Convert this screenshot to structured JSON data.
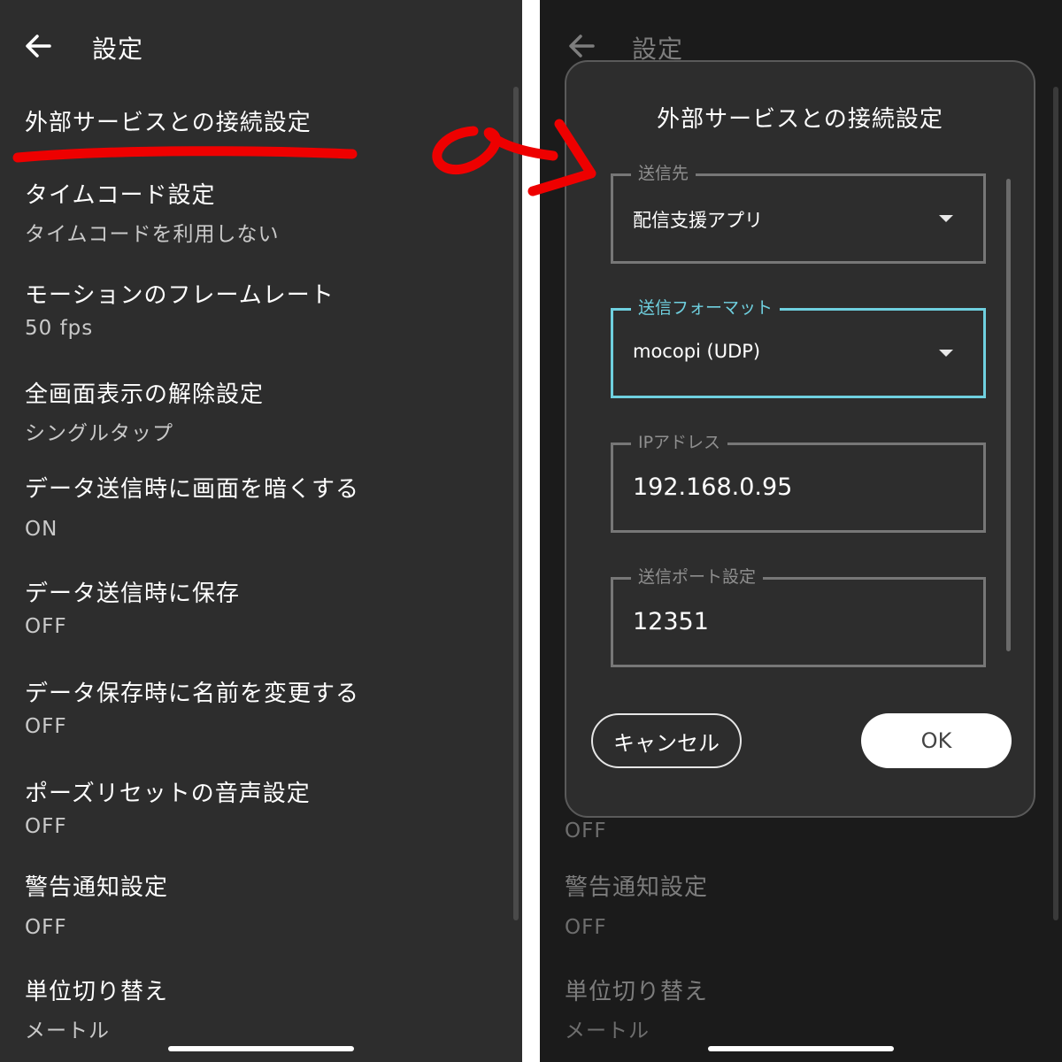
{
  "left": {
    "title": "設定",
    "items": [
      {
        "title": "外部サービスとの接続設定"
      },
      {
        "title": "タイムコード設定",
        "value": "タイムコードを利用しない"
      },
      {
        "title": "モーションのフレームレート",
        "value": "50 fps"
      },
      {
        "title": "全画面表示の解除設定",
        "value": "シングルタップ"
      },
      {
        "title": "データ送信時に画面を暗くする",
        "value": "ON"
      },
      {
        "title": "データ送信時に保存",
        "value": "OFF"
      },
      {
        "title": "データ保存時に名前を変更する",
        "value": "OFF"
      },
      {
        "title": "ポーズリセットの音声設定",
        "value": "OFF"
      },
      {
        "title": "警告通知設定",
        "value": "OFF"
      },
      {
        "title": "単位切り替え",
        "value": "メートル"
      }
    ]
  },
  "right": {
    "title": "設定",
    "background_items": [
      {
        "value": "OFF"
      },
      {
        "title": "警告通知設定",
        "value": "OFF"
      },
      {
        "title": "単位切り替え",
        "value": "メートル"
      }
    ],
    "dialog": {
      "title": "外部サービスとの接続設定",
      "fields": [
        {
          "label": "送信先",
          "value": "配信支援アプリ"
        },
        {
          "label": "送信フォーマット",
          "value": "mocopi (UDP)"
        },
        {
          "label": "IPアドレス",
          "value": "192.168.0.95"
        },
        {
          "label": "送信ポート設定",
          "value": "12351"
        }
      ],
      "cancel_label": "キャンセル",
      "ok_label": "OK"
    }
  },
  "colors": {
    "accent": "#6fd0df",
    "annotation": "#ee0000",
    "panel_bg": "#2d2d2d",
    "dimmed_bg": "#1b1b1b"
  },
  "icons": [
    "back-arrow-icon",
    "dropdown-caret-icon"
  ]
}
